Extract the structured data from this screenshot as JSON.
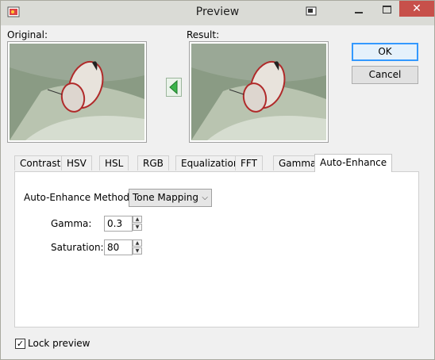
{
  "window": {
    "title": "Preview",
    "close_glyph": "✕"
  },
  "labels": {
    "original": "Original:",
    "result": "Result:"
  },
  "buttons": {
    "ok": "OK",
    "cancel": "Cancel"
  },
  "tabs": [
    "Contrast",
    "HSV",
    "HSL",
    "RGB",
    "Equalization",
    "FFT",
    "Gamma",
    "Auto-Enhance"
  ],
  "active_tab": "Auto-Enhance",
  "auto_enhance": {
    "method_label": "Auto-Enhance Method:",
    "method_value": "Tone Mapping",
    "gamma_label": "Gamma:",
    "gamma_value": "0.3",
    "saturation_label": "Saturation:",
    "saturation_value": "80"
  },
  "lock_preview": {
    "label": "Lock preview",
    "checked": true,
    "check_glyph": "✓"
  },
  "colors": {
    "arrow": "#3cb44b",
    "close": "#c7504a",
    "accent": "#3399ff"
  }
}
